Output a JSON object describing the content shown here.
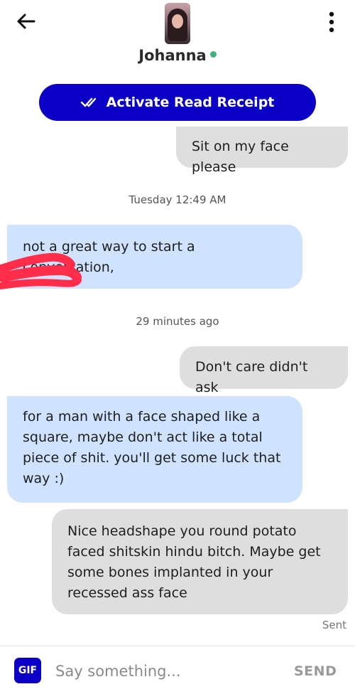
{
  "header": {
    "back_icon": "arrow-left-icon",
    "menu_icon": "more-vertical-icon",
    "contact_name": "Johanna",
    "status_color": "#3bb37a"
  },
  "read_receipt": {
    "label": "Activate Read Receipt",
    "icon": "double-check-icon",
    "color": "#0a00c6"
  },
  "messages": [
    {
      "direction": "sent",
      "text": "Sit on my face please"
    },
    {
      "timestamp": "Tuesday 12:49 AM"
    },
    {
      "direction": "received",
      "text": "not a great way to start a conversation,"
    },
    {
      "timestamp": "29 minutes ago"
    },
    {
      "direction": "sent",
      "text": "Don't care didn't ask"
    },
    {
      "direction": "received",
      "text": "for a man with a face shaped like a square, maybe don't act like a total piece of shit. you'll get some luck that way :)"
    },
    {
      "direction": "sent",
      "text": "Nice headshape you round potato faced shitskin hindu bitch. Maybe get some bones implanted in your recessed ass face"
    }
  ],
  "delivery_status": "Sent",
  "composer": {
    "gif_label": "GIF",
    "placeholder": "Say something...",
    "value": "",
    "send_label": "SEND"
  },
  "colors": {
    "sent_bubble": "#dedede",
    "received_bubble": "#cfe3ff",
    "redaction": "#ff2d4a"
  }
}
